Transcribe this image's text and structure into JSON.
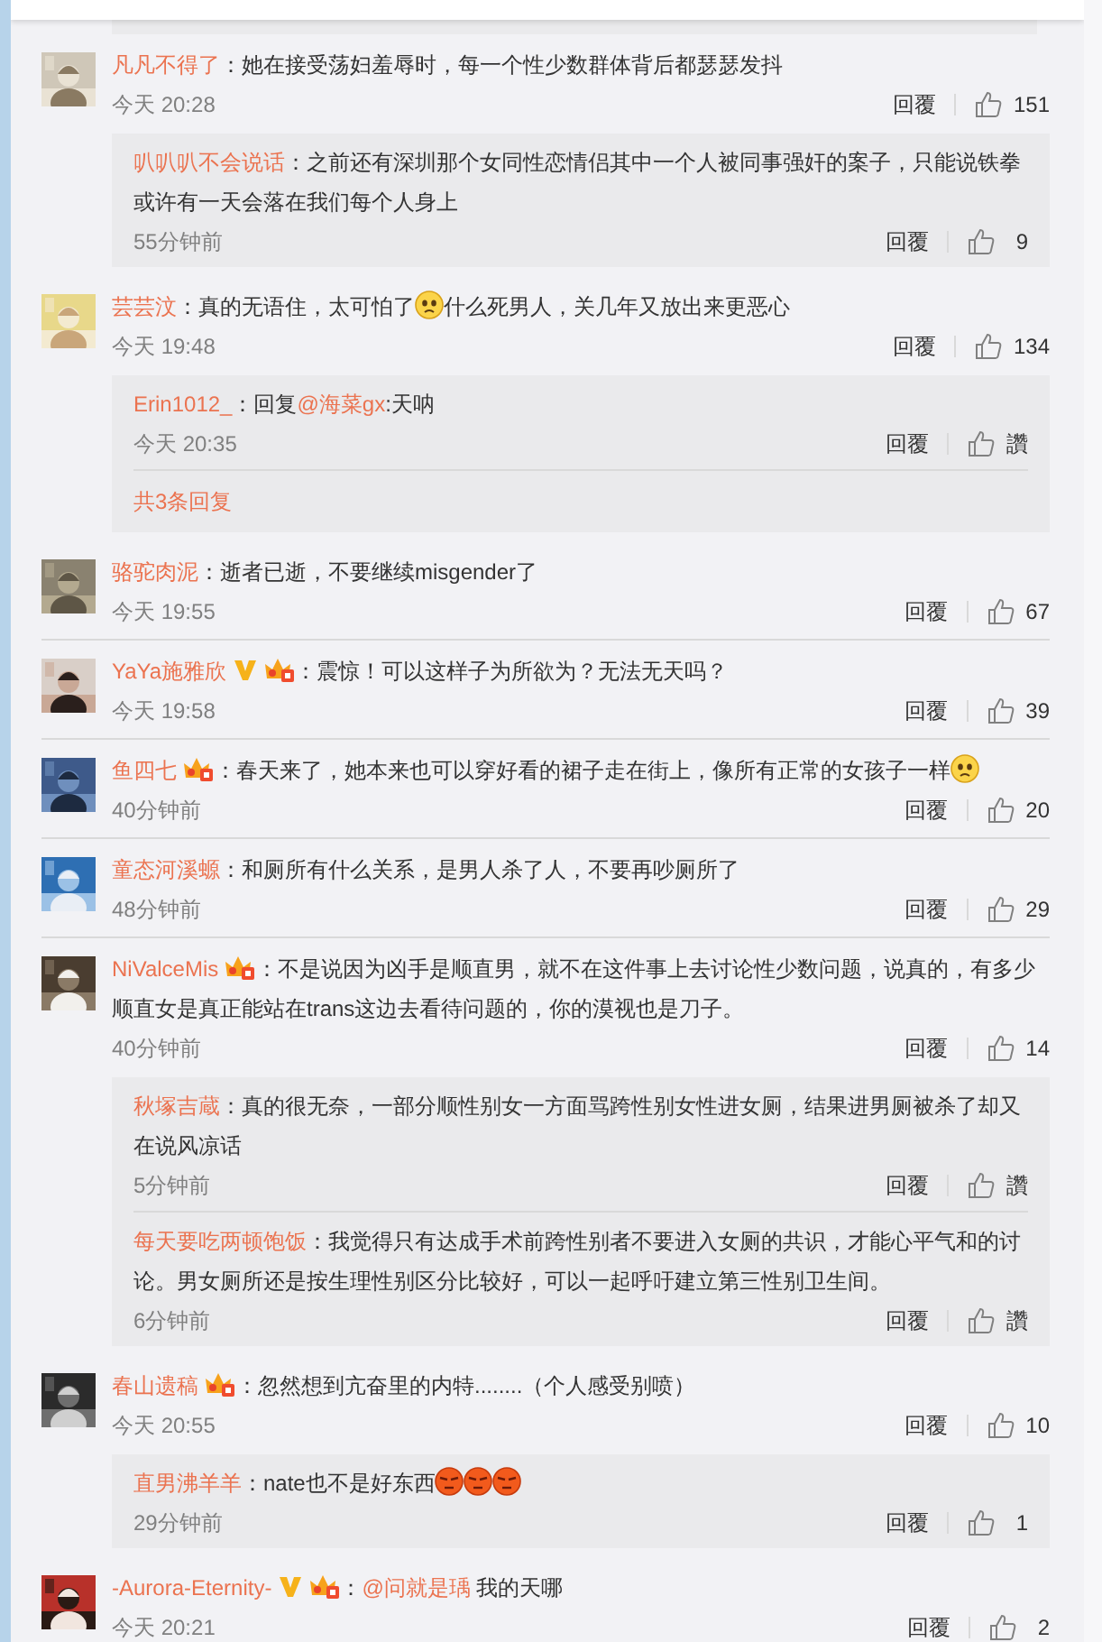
{
  "comments": [
    {
      "avatar": {
        "kind": "picture"
      },
      "name": "凡凡不得了",
      "segments": [
        {
          "kind": "text",
          "text": "：她在接受荡妇羞辱时，每一个性少数群体背后都瑟瑟发抖"
        }
      ],
      "time": "今天 20:28",
      "reply_label": "回覆",
      "likes": "151",
      "replies": [
        {
          "name": "叭叭叭不会说话",
          "segments": [
            {
              "kind": "text",
              "text": "：之前还有深圳那个女同性恋情侣其中一个人被同事强奸的案子，只能说铁拳或许有一天会落在我们每个人身上"
            }
          ],
          "time": "55分钟前",
          "reply_label": "回覆",
          "likes": "9"
        }
      ]
    },
    {
      "avatar": {
        "kind": "picture"
      },
      "name": "芸芸汶",
      "segments": [
        {
          "kind": "text",
          "text": "：真的无语住，太可怕了"
        },
        {
          "kind": "sad-emoji"
        },
        {
          "kind": "text",
          "text": "什么死男人，关几年又放出来更恶心"
        }
      ],
      "time": "今天 19:48",
      "reply_label": "回覆",
      "likes": "134",
      "replies": [
        {
          "name": "Erin1012_",
          "segments": [
            {
              "kind": "text",
              "text": "：回复"
            },
            {
              "kind": "mention",
              "text": "@海菜gx"
            },
            {
              "kind": "text",
              "text": ":天呐"
            }
          ],
          "time": "今天 20:35",
          "reply_label": "回覆",
          "likes": "讚"
        }
      ],
      "more": "共3条回复"
    },
    {
      "avatar": {
        "kind": "picture"
      },
      "name": "骆驼肉泥",
      "segments": [
        {
          "kind": "text",
          "text": "：逝者已逝，不要继续misgender了"
        }
      ],
      "time": "今天 19:55",
      "reply_label": "回覆",
      "likes": "67"
    },
    {
      "avatar": {
        "kind": "picture"
      },
      "name": "YaYa施雅欣",
      "badges": [
        {
          "kind": "verified"
        },
        {
          "kind": "member"
        }
      ],
      "segments": [
        {
          "kind": "text",
          "text": "：震惊！可以这样子为所欲为？无法无天吗？"
        }
      ],
      "time": "今天 19:58",
      "reply_label": "回覆",
      "likes": "39"
    },
    {
      "avatar": {
        "kind": "picture"
      },
      "name": "鱼四七",
      "badges": [
        {
          "kind": "member"
        }
      ],
      "segments": [
        {
          "kind": "text",
          "text": "：春天来了，她本来也可以穿好看的裙子走在街上，像所有正常的女孩子一样"
        },
        {
          "kind": "sad-emoji"
        }
      ],
      "time": "40分钟前",
      "reply_label": "回覆",
      "likes": "20"
    },
    {
      "avatar": {
        "kind": "picture"
      },
      "name": "童态河溪螈",
      "segments": [
        {
          "kind": "text",
          "text": "：和厕所有什么关系，是男人杀了人，不要再吵厕所了"
        }
      ],
      "time": "48分钟前",
      "reply_label": "回覆",
      "likes": "29"
    },
    {
      "avatar": {
        "kind": "picture"
      },
      "name": "NiValceMis",
      "badges": [
        {
          "kind": "member"
        }
      ],
      "segments": [
        {
          "kind": "text",
          "text": "：不是说因为凶手是顺直男，就不在这件事上去讨论性少数问题，说真的，有多少顺直女是真正能站在trans这边去看待问题的，你的漠视也是刀子。"
        }
      ],
      "time": "40分钟前",
      "reply_label": "回覆",
      "likes": "14",
      "replies": [
        {
          "name": "秋塚吉蔵",
          "segments": [
            {
              "kind": "text",
              "text": "：真的很无奈，一部分顺性别女一方面骂跨性别女性进女厕，结果进男厕被杀了却又在说风凉话"
            }
          ],
          "time": "5分钟前",
          "reply_label": "回覆",
          "likes": "讚"
        },
        {
          "name": "每天要吃两顿饱饭",
          "segments": [
            {
              "kind": "text",
              "text": "：我觉得只有达成手术前跨性别者不要进入女厕的共识，才能心平气和的讨论。男女厕所还是按生理性别区分比较好，可以一起呼吁建立第三性别卫生间。"
            }
          ],
          "time": "6分钟前",
          "reply_label": "回覆",
          "likes": "讚"
        }
      ]
    },
    {
      "avatar": {
        "kind": "picture"
      },
      "name": "春山遗稿",
      "badges": [
        {
          "kind": "member"
        }
      ],
      "segments": [
        {
          "kind": "text",
          "text": "：忽然想到亢奋里的内特........（个人感受别喷）"
        }
      ],
      "time": "今天 20:55",
      "reply_label": "回覆",
      "likes": "10",
      "replies": [
        {
          "name": "直男沸羊羊",
          "segments": [
            {
              "kind": "text",
              "text": "：nate也不是好东西"
            },
            {
              "kind": "angry-emoji"
            },
            {
              "kind": "angry-emoji"
            },
            {
              "kind": "angry-emoji"
            }
          ],
          "time": "29分钟前",
          "reply_label": "回覆",
          "likes": "1"
        }
      ]
    },
    {
      "avatar": {
        "kind": "picture"
      },
      "name": "-Aurora-Eternity-",
      "badges": [
        {
          "kind": "verified"
        },
        {
          "kind": "member"
        }
      ],
      "segments": [
        {
          "kind": "text",
          "text": "："
        },
        {
          "kind": "mention",
          "text": "@问就是瑀"
        },
        {
          "kind": "text",
          "text": " 我的天哪"
        }
      ],
      "time": "今天 20:21",
      "reply_label": "回覆",
      "likes": "2"
    }
  ]
}
